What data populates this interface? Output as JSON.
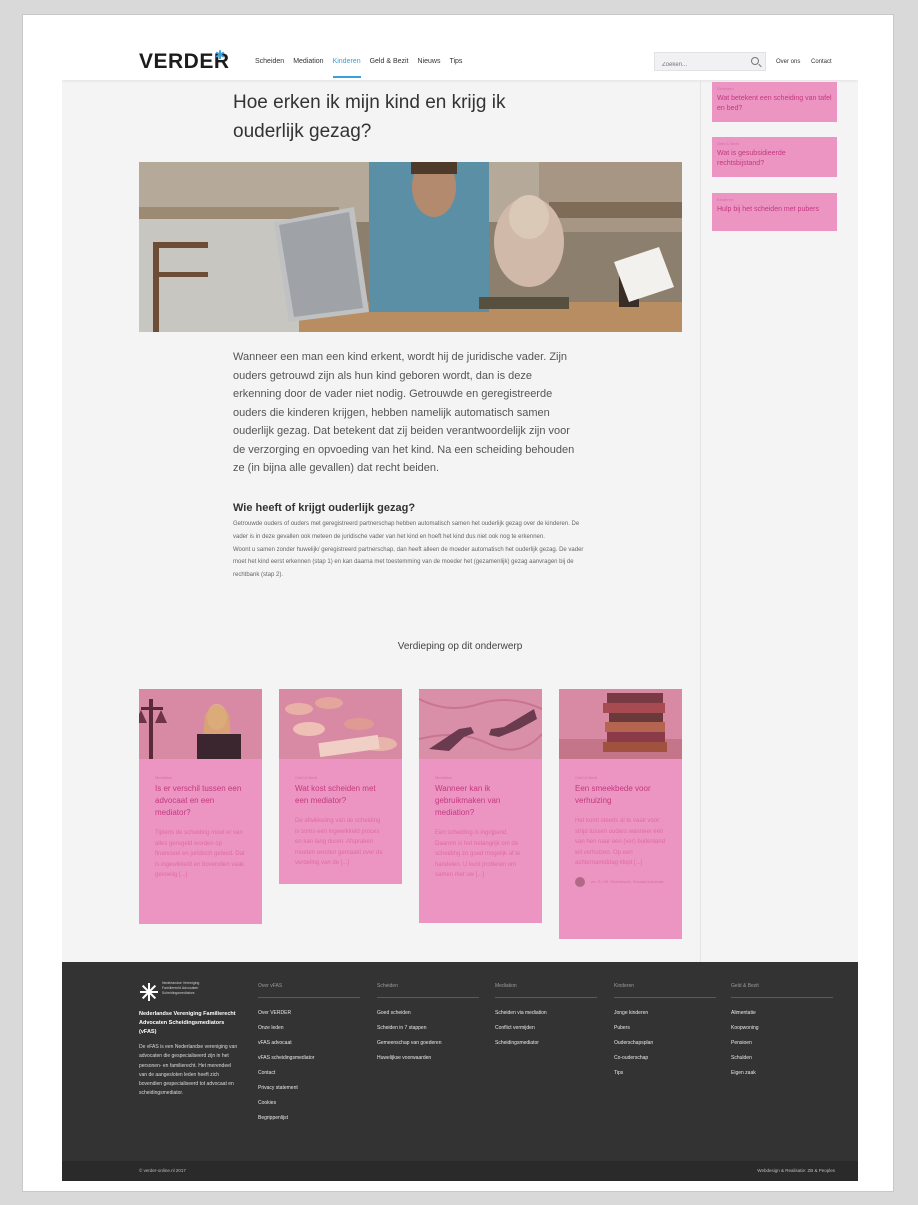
{
  "header": {
    "logo": "VERDER",
    "nav": [
      "Scheiden",
      "Mediation",
      "Kinderen",
      "Geld & Bezit",
      "Nieuws",
      "Tips"
    ],
    "active_nav": "Kinderen",
    "search_placeholder": "Zoeken...",
    "links": [
      "Over ons",
      "Contact"
    ]
  },
  "colors": {
    "accent": "#3aa0d8",
    "pink_card": "#ec95c3",
    "pink_text": "#c2397f",
    "footer_bg": "#333333"
  },
  "article": {
    "title": "Hoe erken ik mijn kind en krijg ik ouderlijk gezag?",
    "lead": "Wanneer een man een kind erkent, wordt hij de juridische vader. Zijn ouders getrouwd zijn als hun kind geboren wordt, dan is deze erkenning door de vader niet nodig. Getrouwde en geregistreerde ouders die kinderen krijgen, hebben namelijk automatisch samen ouderlijk gezag. Dat betekent dat zij beiden verantwoordelijk zijn voor de verzorging en opvoeding van het kind. Na een scheiding behouden ze (in bijna alle gevallen) dat recht beiden.",
    "heading": "Wie heeft of krijgt ouderlijk gezag?",
    "body_p1": "Getrouwde ouders of ouders met geregistreerd partnerschap hebben automatisch samen het ouderlijk gezag over de kinderen. De vader is in deze gevallen ook meteen de juridische vader van het kind en hoeft het kind dus niet ook nog te erkennen.",
    "body_p2": "Woont u samen zonder huwelijk/ geregistreerd partnerschap, dan heeft alleen de moeder automatisch het ouderlijk gezag. De vader moet het kind eerst erkennen (stap 1) en kan daarna met toestemming van de moeder het (gezamenlijk) gezag aanvragen bij de rechtbank (stap 2)."
  },
  "sidebar": [
    {
      "category": "Scheiden",
      "title": "Wat betekent een scheiding van tafel en bed?"
    },
    {
      "category": "Geld & Bezit",
      "title": "Wat is gesubsidieerde rechtsbijstand?"
    },
    {
      "category": "Kinderen",
      "title": "Hulp bij het scheiden met pubers"
    }
  ],
  "related": {
    "title": "Verdieping op dit onderwerp",
    "cards": [
      {
        "category": "Mediation",
        "title": "Is er verschil tussen een advocaat en een mediator?",
        "excerpt": "Tijdens de scheiding moet er van alles geregeld worden op financieel en juridisch gebied. Dat is ingewikkeld en bovendien vaak gevoelig [...]"
      },
      {
        "category": "Geld & Bezit",
        "title": "Wat kost scheiden met een mediator?",
        "excerpt": "De afwikkeling van de scheiding is soms een ingewikkeld proces en kan lang duren. Afspraken moeten worden gemaakt over de verdeling van de [...]"
      },
      {
        "category": "Mediation",
        "title": "Wanneer kan ik gebruikmaken van mediation?",
        "excerpt": "Een scheiding is ingrijpend. Daarom is het belangrijk om de scheiding zo goed mogelijk af te handelen. U kunt proberen om samen met uw [...]"
      },
      {
        "category": "Geld & Bezit",
        "title": "Een smeekbede voor verhuizing",
        "excerpt": "Het komt steeds al te vaak voor: strijd tussen ouders wanneer één van hen naar een (ver) buitenland wil verhuizen. Op een achternamiddag klopt [...]",
        "author": "mr. G.J.M. Elsenbroek, Sociaal Advocaat"
      }
    ]
  },
  "footer": {
    "brand_lines": [
      "Nederlandse Vereniging",
      "Familierecht Advocaten",
      "Scheidingsmediators"
    ],
    "org": "Nederlandse Vereniging Familierecht Advocaten Scheidingsmediators (vFAS)",
    "about": "De vFAS is een Nederlandse vereniging van advocaten die gespecialiseerd zijn in het personen- en familierecht. Het merendeel van de aangesloten leden heeft zich bovendien gespecialiseerd tot advocaat en scheidingsmediator.",
    "columns": [
      {
        "heading": "Over vFAS",
        "links": [
          "Over VERDER",
          "Onze leden",
          "vFAS advocaat",
          "vFAS scheidingsmediator",
          "Contact",
          "Privacy statement",
          "Cookies",
          "Begrippenlijst"
        ]
      },
      {
        "heading": "Scheiden",
        "links": [
          "Goed scheiden",
          "Scheiden in 7 stappen",
          "Gemeenschap van goederen",
          "Huwelijkse voorwaarden"
        ]
      },
      {
        "heading": "Mediation",
        "links": [
          "Scheiden via mediation",
          "Conflict vermijden",
          "Scheidingsmediator"
        ]
      },
      {
        "heading": "Kinderen",
        "links": [
          "Jonge kinderen",
          "Pubers",
          "Ouderschapsplan",
          "Co-ouderschap",
          "Tips"
        ]
      },
      {
        "heading": "Geld & Bezit",
        "links": [
          "Alimentatie",
          "Koopwoning",
          "Pensioen",
          "Schulden",
          "Eigen zaak"
        ]
      }
    ],
    "copyright": "© verder-online.nl 2017",
    "credit": "Webdesign & Realisatie: ZB & Peoples"
  }
}
